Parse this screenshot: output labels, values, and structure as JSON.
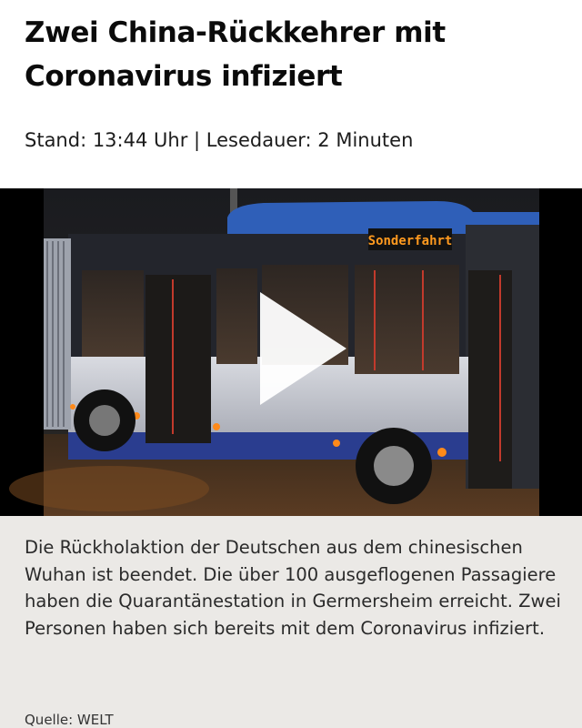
{
  "article": {
    "headline": "Zwei China-Rückkehrer mit Coronavirus infiziert",
    "meta": "Stand: 13:44 Uhr | Lesedauer: 2 Minuten"
  },
  "video": {
    "bus_destination_sign": "Sonderfahrt",
    "play_icon": "play-icon"
  },
  "teaser": {
    "text": "Die Rückholaktion der Deutschen aus dem chinesischen Wuhan ist beendet. Die über 100 ausgeflogenen Passagiere haben die Quarantänestation in Germersheim erreicht. Zwei Personen haben sich bereits mit dem Coronavirus infiziert.",
    "source": "Quelle: WELT"
  },
  "colors": {
    "bus_roof": "#2f5fb8",
    "bus_stripe": "#2a3d8f",
    "sign_text": "#ff9a1f",
    "teaser_bg": "#ebe9e6"
  }
}
